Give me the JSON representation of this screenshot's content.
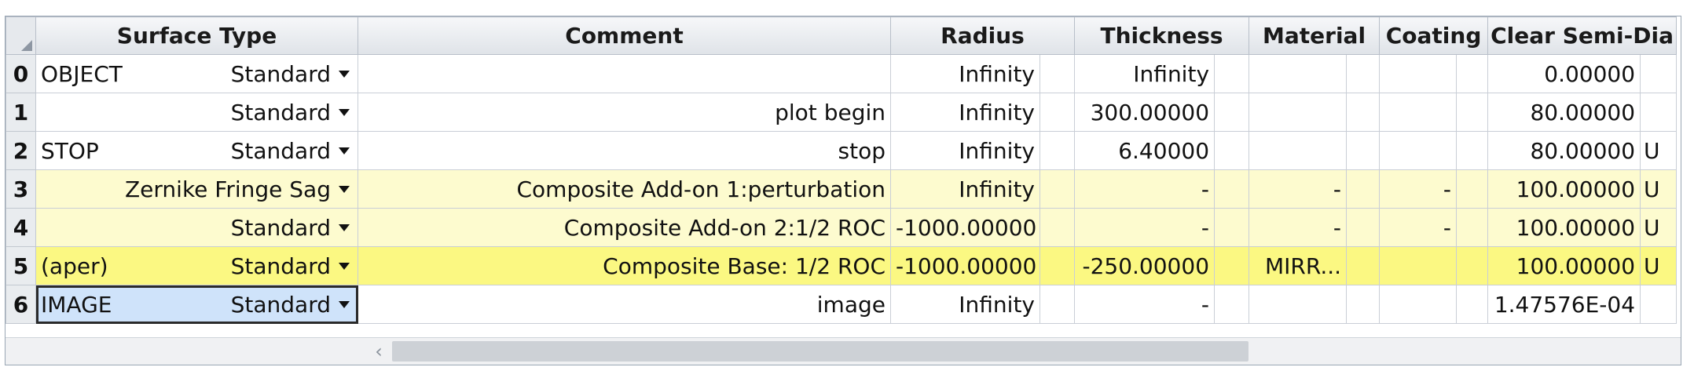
{
  "columns": {
    "surface_type": "Surface Type",
    "comment": "Comment",
    "radius": "Radius",
    "thickness": "Thickness",
    "material": "Material",
    "coating": "Coating",
    "clear_semi_dia": "Clear Semi-Dia"
  },
  "rows": [
    {
      "num": "0",
      "label": "OBJECT",
      "type": "Standard",
      "comment": "",
      "radius": "Infinity",
      "radius_solve": "",
      "thickness": "Infinity",
      "thickness_solve": "",
      "material": "",
      "material_solve": "",
      "coating": "",
      "coating_solve": "",
      "semi_dia": "0.00000",
      "semi_dia_solve": "",
      "highlight": "none"
    },
    {
      "num": "1",
      "label": "",
      "type": "Standard",
      "comment": "plot begin",
      "radius": "Infinity",
      "radius_solve": "",
      "thickness": "300.00000",
      "thickness_solve": "",
      "material": "",
      "material_solve": "",
      "coating": "",
      "coating_solve": "",
      "semi_dia": "80.00000",
      "semi_dia_solve": "",
      "highlight": "none"
    },
    {
      "num": "2",
      "label": "STOP",
      "type": "Standard",
      "comment": "stop",
      "radius": "Infinity",
      "radius_solve": "",
      "thickness": "6.40000",
      "thickness_solve": "",
      "material": "",
      "material_solve": "",
      "coating": "",
      "coating_solve": "",
      "semi_dia": "80.00000",
      "semi_dia_solve": "U",
      "highlight": "none"
    },
    {
      "num": "3",
      "label": "",
      "type": "Zernike Fringe Sag",
      "comment": "Composite Add-on 1:perturbation",
      "radius": "Infinity",
      "radius_solve": "",
      "thickness": "-",
      "thickness_solve": "",
      "material": "-",
      "material_solve": "",
      "coating": "-",
      "coating_solve": "",
      "semi_dia": "100.00000",
      "semi_dia_solve": "U",
      "highlight": "light"
    },
    {
      "num": "4",
      "label": "",
      "type": "Standard",
      "comment": "Composite Add-on 2:1/2 ROC",
      "radius": "-1000.00000",
      "radius_solve": "",
      "thickness": "-",
      "thickness_solve": "",
      "material": "-",
      "material_solve": "",
      "coating": "-",
      "coating_solve": "",
      "semi_dia": "100.00000",
      "semi_dia_solve": "U",
      "highlight": "light"
    },
    {
      "num": "5",
      "label": "(aper)",
      "type": "Standard",
      "comment": "Composite Base: 1/2 ROC",
      "radius": "-1000.00000",
      "radius_solve": "",
      "thickness": "-250.00000",
      "thickness_solve": "",
      "material": "MIRR...",
      "material_solve": "",
      "coating": "",
      "coating_solve": "",
      "semi_dia": "100.00000",
      "semi_dia_solve": "U",
      "highlight": "bright"
    },
    {
      "num": "6",
      "label": "IMAGE",
      "type": "Standard",
      "comment": "image",
      "radius": "Infinity",
      "radius_solve": "",
      "thickness": "-",
      "thickness_solve": "",
      "material": "",
      "material_solve": "",
      "coating": "",
      "coating_solve": "",
      "semi_dia": "1.47576E-04",
      "semi_dia_solve": "",
      "highlight": "none"
    }
  ],
  "colors": {
    "light_highlight": "#fdfbcf",
    "bright_highlight": "#fbf882",
    "selected_cell": "#cfe3fa"
  },
  "icons": {
    "dropdown": "chevron-down-icon",
    "scroll_left": "chevron-left-icon"
  }
}
